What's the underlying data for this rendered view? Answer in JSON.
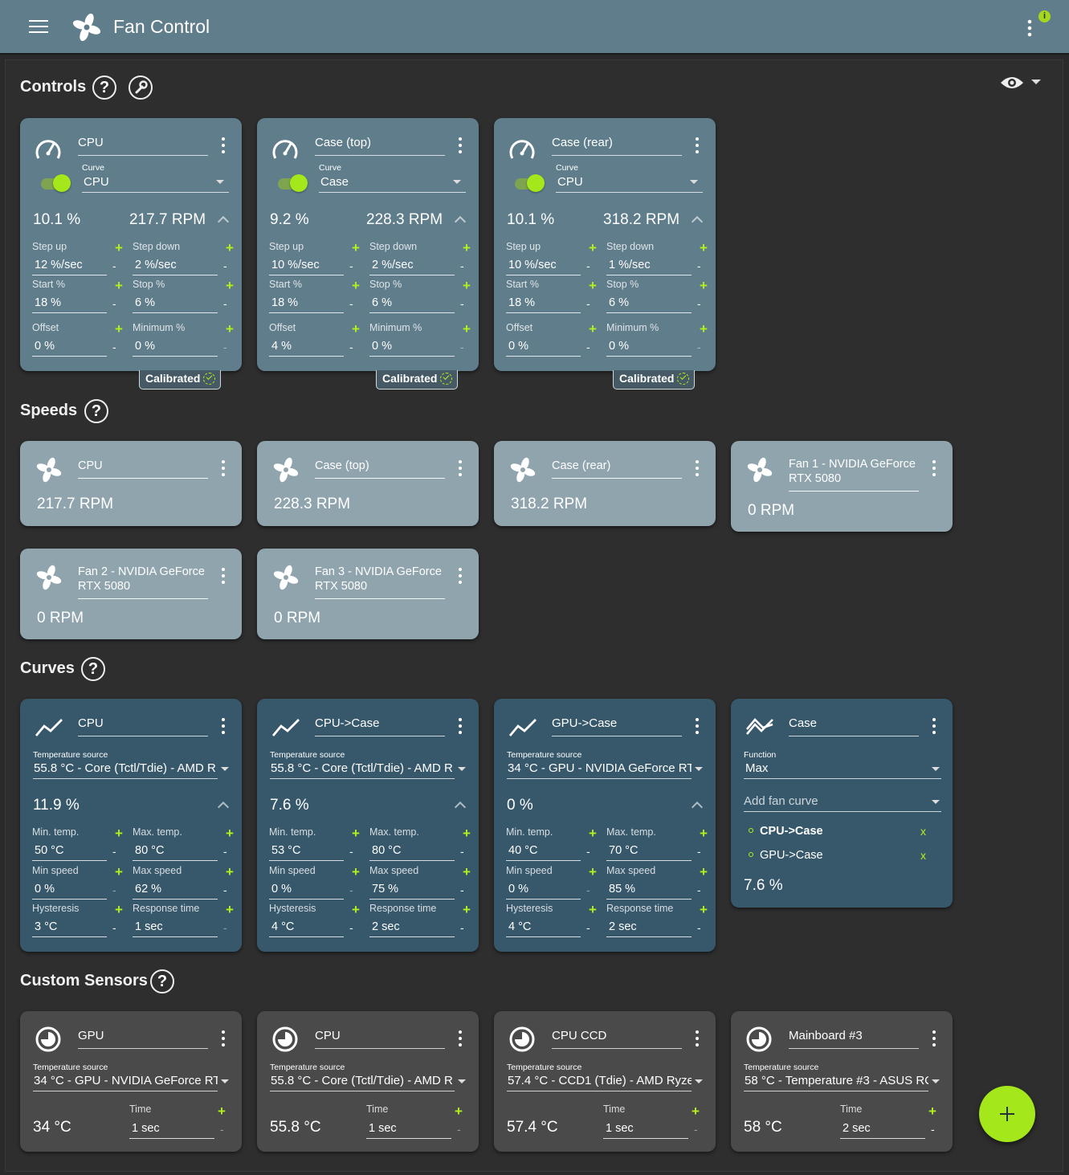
{
  "app": {
    "title": "Fan Control",
    "notification_badge": "i",
    "accent": "#a4e81c",
    "header_color": "#607d8b"
  },
  "sections": {
    "controls": "Controls",
    "speeds": "Speeds",
    "curves": "Curves",
    "custom_sensors": "Custom Sensors",
    "help_glyph": "?"
  },
  "controls": [
    {
      "name": "CPU",
      "curve_label": "Curve",
      "curve": "CPU",
      "percent": "10.1 %",
      "rpm": "217.7 RPM",
      "enabled": true,
      "step_up_label": "Step up",
      "step_up": "12 %/sec",
      "step_down_label": "Step down",
      "step_down": "2 %/sec",
      "start_label": "Start %",
      "start": "18 %",
      "stop_label": "Stop %",
      "stop": "6 %",
      "offset_label": "Offset",
      "offset": "0 %",
      "minimum_label": "Minimum %",
      "minimum": "0 %",
      "calibrated": "Calibrated"
    },
    {
      "name": "Case (top)",
      "curve_label": "Curve",
      "curve": "Case",
      "percent": "9.2 %",
      "rpm": "228.3 RPM",
      "enabled": true,
      "step_up_label": "Step up",
      "step_up": "10 %/sec",
      "step_down_label": "Step down",
      "step_down": "2 %/sec",
      "start_label": "Start %",
      "start": "18 %",
      "stop_label": "Stop %",
      "stop": "6 %",
      "offset_label": "Offset",
      "offset": "4 %",
      "minimum_label": "Minimum %",
      "minimum": "0 %",
      "calibrated": "Calibrated"
    },
    {
      "name": "Case (rear)",
      "curve_label": "Curve",
      "curve": "CPU",
      "percent": "10.1 %",
      "rpm": "318.2 RPM",
      "enabled": true,
      "step_up_label": "Step up",
      "step_up": "10 %/sec",
      "step_down_label": "Step down",
      "step_down": "1 %/sec",
      "start_label": "Start %",
      "start": "18 %",
      "stop_label": "Stop %",
      "stop": "6 %",
      "offset_label": "Offset",
      "offset": "0 %",
      "minimum_label": "Minimum %",
      "minimum": "0 %",
      "calibrated": "Calibrated"
    }
  ],
  "speeds": [
    {
      "name": "CPU",
      "rpm": "217.7 RPM"
    },
    {
      "name": "Case (top)",
      "rpm": "228.3 RPM"
    },
    {
      "name": "Case (rear)",
      "rpm": "318.2 RPM"
    },
    {
      "name_line1": "Fan 1 - NVIDIA GeForce",
      "name_line2": "RTX 5080",
      "rpm": "0 RPM"
    },
    {
      "name_line1": "Fan 2 - NVIDIA GeForce",
      "name_line2": "RTX 5080",
      "rpm": "0 RPM"
    },
    {
      "name_line1": "Fan 3 - NVIDIA GeForce",
      "name_line2": "RTX 5080",
      "rpm": "0 RPM"
    }
  ],
  "curves": [
    {
      "name": "CPU",
      "source_label": "Temperature source",
      "source": "55.8 °C - Core (Tctl/Tdie) - AMD R",
      "value": "11.9 %",
      "min_temp_label": "Min. temp.",
      "min_temp": "50 °C",
      "max_temp_label": "Max. temp.",
      "max_temp": "80 °C",
      "min_speed_label": "Min speed",
      "min_speed": "0 %",
      "max_speed_label": "Max speed",
      "max_speed": "62 %",
      "hysteresis_label": "Hysteresis",
      "hysteresis": "3 °C",
      "response_label": "Response time",
      "response": "1 sec"
    },
    {
      "name": "CPU->Case",
      "source_label": "Temperature source",
      "source": "55.8 °C - Core (Tctl/Tdie) - AMD R",
      "value": "7.6 %",
      "min_temp_label": "Min. temp.",
      "min_temp": "53 °C",
      "max_temp_label": "Max. temp.",
      "max_temp": "80 °C",
      "min_speed_label": "Min speed",
      "min_speed": "0 %",
      "max_speed_label": "Max speed",
      "max_speed": "75 %",
      "hysteresis_label": "Hysteresis",
      "hysteresis": "4 °C",
      "response_label": "Response time",
      "response": "2 sec"
    },
    {
      "name": "GPU->Case",
      "source_label": "Temperature source",
      "source": "34 °C - GPU - NVIDIA GeForce RT)",
      "value": "0 %",
      "min_temp_label": "Min. temp.",
      "min_temp": "40 °C",
      "max_temp_label": "Max. temp.",
      "max_temp": "70 °C",
      "min_speed_label": "Min speed",
      "min_speed": "0 %",
      "max_speed_label": "Max speed",
      "max_speed": "85 %",
      "hysteresis_label": "Hysteresis",
      "hysteresis": "4 °C",
      "response_label": "Response time",
      "response": "2 sec"
    }
  ],
  "mix_curve": {
    "name": "Case",
    "function_label": "Function",
    "function": "Max",
    "add_placeholder": "Add fan curve",
    "items": [
      "CPU->Case",
      "GPU->Case"
    ],
    "remove_glyph": "x",
    "value": "7.6 %"
  },
  "sensors": [
    {
      "name": "GPU",
      "source_label": "Temperature source",
      "source": "34 °C - GPU - NVIDIA GeForce RT)",
      "value": "34 °C",
      "time_label": "Time",
      "time": "1 sec"
    },
    {
      "name": "CPU",
      "source_label": "Temperature source",
      "source": "55.8 °C - Core (Tctl/Tdie) - AMD R",
      "value": "55.8 °C",
      "time_label": "Time",
      "time": "1 sec"
    },
    {
      "name": "CPU CCD",
      "source_label": "Temperature source",
      "source": "57.4 °C - CCD1 (Tdie) - AMD Ryzei",
      "value": "57.4 °C",
      "time_label": "Time",
      "time": "1 sec"
    },
    {
      "name": "Mainboard #3",
      "source_label": "Temperature source",
      "source": "58 °C - Temperature #3 - ASUS RC",
      "value": "58 °C",
      "time_label": "Time",
      "time": "2 sec"
    }
  ],
  "glyphs": {
    "plus": "+",
    "minus": "-"
  }
}
